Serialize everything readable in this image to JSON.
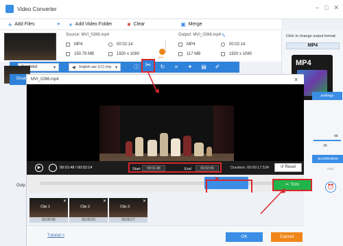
{
  "app": {
    "title": "Video Converter",
    "window_controls": [
      "–",
      "□",
      "✕"
    ]
  },
  "toolbar": {
    "add_files": "Add Files",
    "add_folder": "Add Video Folder",
    "clear": "Clear",
    "merge": "Merge"
  },
  "file": {
    "source_label": "Source: MVI_0266.mp4",
    "output_label": "Output: MVI_0266.mp4",
    "src_format": "MP4",
    "src_duration": "00:02:14",
    "src_size": "150.79 MB",
    "src_resolution": "1920 x 1080",
    "out_format": "MP4",
    "out_duration": "00:02:14",
    "out_size": "117 MB",
    "out_resolution": "1920 x 1080",
    "target_text": "10%"
  },
  "edit_bar": {
    "subtitle_select": "Disabled",
    "audio_select": "English aac (LC) (mp"
  },
  "right_panel": {
    "title": "Click to change output format:",
    "format": "MP4",
    "settings": "settings",
    "k_label": "2K",
    "k4_label": "4K",
    "acceleration": "acceleration",
    "load_label": "load"
  },
  "sidebar": {
    "disabled": "Disabled",
    "outp": "Outp"
  },
  "dialog": {
    "title": "MVI_0266.mp4",
    "player": {
      "current_time": "00:01:48",
      "total_time": "00:02:14",
      "start_label": "Start",
      "start_value": "00:01:48",
      "end_label": "End",
      "end_value": "00:02:06",
      "duration_label": "Duration:",
      "duration_value": "00:00:17.534",
      "reset": "Reset"
    },
    "trim": "Trim",
    "timeline_progress": 0.77,
    "clips": [
      {
        "name": "Clip 1",
        "duration": "00:00:36"
      },
      {
        "name": "Clip 2",
        "duration": "00:00:23"
      },
      {
        "name": "Clip 3",
        "duration": "00:00:17"
      }
    ],
    "tutorial": "Tutorial >",
    "ok": "OK",
    "cancel": "Cancel"
  },
  "colors": {
    "accent_blue": "#3a8ee6",
    "trim_green": "#21b44a",
    "cancel_orange": "#f0861a",
    "highlight_red": "#d9262c"
  }
}
